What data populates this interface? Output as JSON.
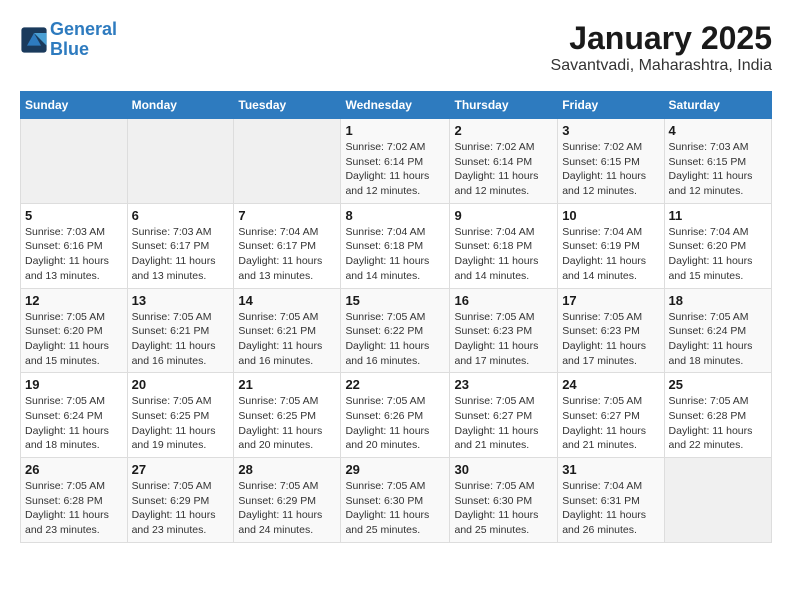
{
  "header": {
    "logo_line1": "General",
    "logo_line2": "Blue",
    "title": "January 2025",
    "subtitle": "Savantvadi, Maharashtra, India"
  },
  "weekdays": [
    "Sunday",
    "Monday",
    "Tuesday",
    "Wednesday",
    "Thursday",
    "Friday",
    "Saturday"
  ],
  "weeks": [
    [
      {
        "day": "",
        "info": ""
      },
      {
        "day": "",
        "info": ""
      },
      {
        "day": "",
        "info": ""
      },
      {
        "day": "1",
        "info": "Sunrise: 7:02 AM\nSunset: 6:14 PM\nDaylight: 11 hours and 12 minutes."
      },
      {
        "day": "2",
        "info": "Sunrise: 7:02 AM\nSunset: 6:14 PM\nDaylight: 11 hours and 12 minutes."
      },
      {
        "day": "3",
        "info": "Sunrise: 7:02 AM\nSunset: 6:15 PM\nDaylight: 11 hours and 12 minutes."
      },
      {
        "day": "4",
        "info": "Sunrise: 7:03 AM\nSunset: 6:15 PM\nDaylight: 11 hours and 12 minutes."
      }
    ],
    [
      {
        "day": "5",
        "info": "Sunrise: 7:03 AM\nSunset: 6:16 PM\nDaylight: 11 hours and 13 minutes."
      },
      {
        "day": "6",
        "info": "Sunrise: 7:03 AM\nSunset: 6:17 PM\nDaylight: 11 hours and 13 minutes."
      },
      {
        "day": "7",
        "info": "Sunrise: 7:04 AM\nSunset: 6:17 PM\nDaylight: 11 hours and 13 minutes."
      },
      {
        "day": "8",
        "info": "Sunrise: 7:04 AM\nSunset: 6:18 PM\nDaylight: 11 hours and 14 minutes."
      },
      {
        "day": "9",
        "info": "Sunrise: 7:04 AM\nSunset: 6:18 PM\nDaylight: 11 hours and 14 minutes."
      },
      {
        "day": "10",
        "info": "Sunrise: 7:04 AM\nSunset: 6:19 PM\nDaylight: 11 hours and 14 minutes."
      },
      {
        "day": "11",
        "info": "Sunrise: 7:04 AM\nSunset: 6:20 PM\nDaylight: 11 hours and 15 minutes."
      }
    ],
    [
      {
        "day": "12",
        "info": "Sunrise: 7:05 AM\nSunset: 6:20 PM\nDaylight: 11 hours and 15 minutes."
      },
      {
        "day": "13",
        "info": "Sunrise: 7:05 AM\nSunset: 6:21 PM\nDaylight: 11 hours and 16 minutes."
      },
      {
        "day": "14",
        "info": "Sunrise: 7:05 AM\nSunset: 6:21 PM\nDaylight: 11 hours and 16 minutes."
      },
      {
        "day": "15",
        "info": "Sunrise: 7:05 AM\nSunset: 6:22 PM\nDaylight: 11 hours and 16 minutes."
      },
      {
        "day": "16",
        "info": "Sunrise: 7:05 AM\nSunset: 6:23 PM\nDaylight: 11 hours and 17 minutes."
      },
      {
        "day": "17",
        "info": "Sunrise: 7:05 AM\nSunset: 6:23 PM\nDaylight: 11 hours and 17 minutes."
      },
      {
        "day": "18",
        "info": "Sunrise: 7:05 AM\nSunset: 6:24 PM\nDaylight: 11 hours and 18 minutes."
      }
    ],
    [
      {
        "day": "19",
        "info": "Sunrise: 7:05 AM\nSunset: 6:24 PM\nDaylight: 11 hours and 18 minutes."
      },
      {
        "day": "20",
        "info": "Sunrise: 7:05 AM\nSunset: 6:25 PM\nDaylight: 11 hours and 19 minutes."
      },
      {
        "day": "21",
        "info": "Sunrise: 7:05 AM\nSunset: 6:25 PM\nDaylight: 11 hours and 20 minutes."
      },
      {
        "day": "22",
        "info": "Sunrise: 7:05 AM\nSunset: 6:26 PM\nDaylight: 11 hours and 20 minutes."
      },
      {
        "day": "23",
        "info": "Sunrise: 7:05 AM\nSunset: 6:27 PM\nDaylight: 11 hours and 21 minutes."
      },
      {
        "day": "24",
        "info": "Sunrise: 7:05 AM\nSunset: 6:27 PM\nDaylight: 11 hours and 21 minutes."
      },
      {
        "day": "25",
        "info": "Sunrise: 7:05 AM\nSunset: 6:28 PM\nDaylight: 11 hours and 22 minutes."
      }
    ],
    [
      {
        "day": "26",
        "info": "Sunrise: 7:05 AM\nSunset: 6:28 PM\nDaylight: 11 hours and 23 minutes."
      },
      {
        "day": "27",
        "info": "Sunrise: 7:05 AM\nSunset: 6:29 PM\nDaylight: 11 hours and 23 minutes."
      },
      {
        "day": "28",
        "info": "Sunrise: 7:05 AM\nSunset: 6:29 PM\nDaylight: 11 hours and 24 minutes."
      },
      {
        "day": "29",
        "info": "Sunrise: 7:05 AM\nSunset: 6:30 PM\nDaylight: 11 hours and 25 minutes."
      },
      {
        "day": "30",
        "info": "Sunrise: 7:05 AM\nSunset: 6:30 PM\nDaylight: 11 hours and 25 minutes."
      },
      {
        "day": "31",
        "info": "Sunrise: 7:04 AM\nSunset: 6:31 PM\nDaylight: 11 hours and 26 minutes."
      },
      {
        "day": "",
        "info": ""
      }
    ]
  ]
}
